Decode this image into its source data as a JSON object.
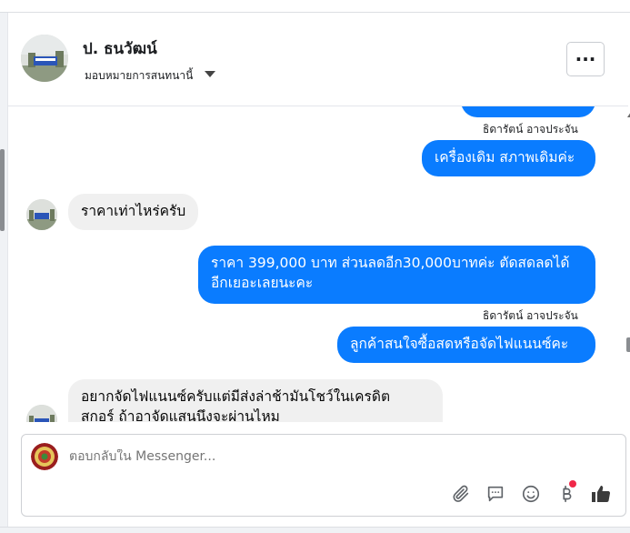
{
  "header": {
    "page_name": "ป. ธนวัฒน์",
    "assign_label": "มอบหมายการสนทนานี้",
    "more_label": "···"
  },
  "conversation": {
    "sender_label_1": "ธิดารัตน์ อาจประจัน",
    "msg_out_1": "เครื่องเดิม สภาพเดิมค่ะ",
    "msg_in_1": "ราคาเท่าไหร่ครับ",
    "msg_out_2_line1": "ราคา 399,000 บาท ส่วนลดอีก30,000บาทค่ะ ตัดสดลดได้",
    "msg_out_2_line2": "อีกเยอะเลยนะคะ",
    "sender_label_2": "ธิดารัตน์ อาจประจัน",
    "msg_out_3": "ลูกค้าสนใจซื้อสดหรือจัดไฟแนนซ์คะ",
    "msg_in_2_line1": "อยากจัดไฟแนนซ์ครับแต่มีส่งล่าช้ามันโชว์ในเครดิต",
    "msg_in_2_line2": "สกอร์ ถ้าอาจัดแสนนึงจะผ่านไหม"
  },
  "composer": {
    "placeholder": "ตอบกลับใน Messenger...",
    "tools": [
      "paperclip-icon",
      "saved-reply-icon",
      "emoji-icon",
      "baht-icon",
      "like-icon"
    ]
  },
  "colors": {
    "outgoing_bubble": "#0a7cff",
    "incoming_bubble": "#f0f0f0",
    "notification_dot": "#f02849"
  }
}
